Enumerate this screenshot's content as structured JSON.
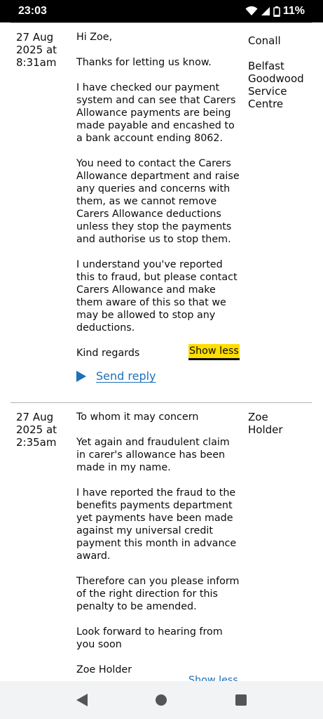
{
  "status_bar": {
    "time": "23:03",
    "battery": "11%",
    "icons": [
      "wifi-icon",
      "signal-icon",
      "battery-icon"
    ]
  },
  "messages": [
    {
      "date_line1": "27 Aug",
      "date_line2": "2025 at",
      "date_line3": "8:31am",
      "sender_name": "Conall",
      "sender_org": "Belfast Goodwood Service Centre",
      "paragraphs": [
        "Hi Zoe,",
        "Thanks for letting us know.",
        "I have checked our payment system and can see that Carers Allowance payments are being made payable and encashed to a bank account ending 8062.",
        "You need to contact the Carers Allowance department and raise any queries and concerns with them, as we cannot remove Carers Allowance deductions unless they stop the payments and authorise us to stop them.",
        "I understand you've reported this to fraud, but please contact Carers Allowance and make them aware of this so that we may be allowed to stop any deductions.",
        "Kind regards"
      ],
      "show_less_label": "Show less",
      "send_reply_label": "Send reply"
    },
    {
      "date_line1": "27 Aug",
      "date_line2": "2025 at",
      "date_line3": "2:35am",
      "sender_name": "Zoe Holder",
      "paragraphs": [
        "To whom it may concern",
        "Yet again and fraudulent claim in carer's allowance has been made in my name.",
        "I have reported the fraud to the benefits payments department yet payments have been made against my universal credit payment this month in advance award.",
        "Therefore can you please inform of the right direction for this penalty to be amended.",
        "Look forward to hearing from you soon",
        "Zoe Holder"
      ],
      "show_less_label": "Show less"
    }
  ],
  "colors": {
    "link": "#1d70b8",
    "highlight": "#ffdd00",
    "text": "#0b0c0c",
    "divider": "#b1b4b6"
  },
  "nav_bar": {
    "icons": [
      "back-icon",
      "home-icon",
      "recents-icon"
    ]
  }
}
